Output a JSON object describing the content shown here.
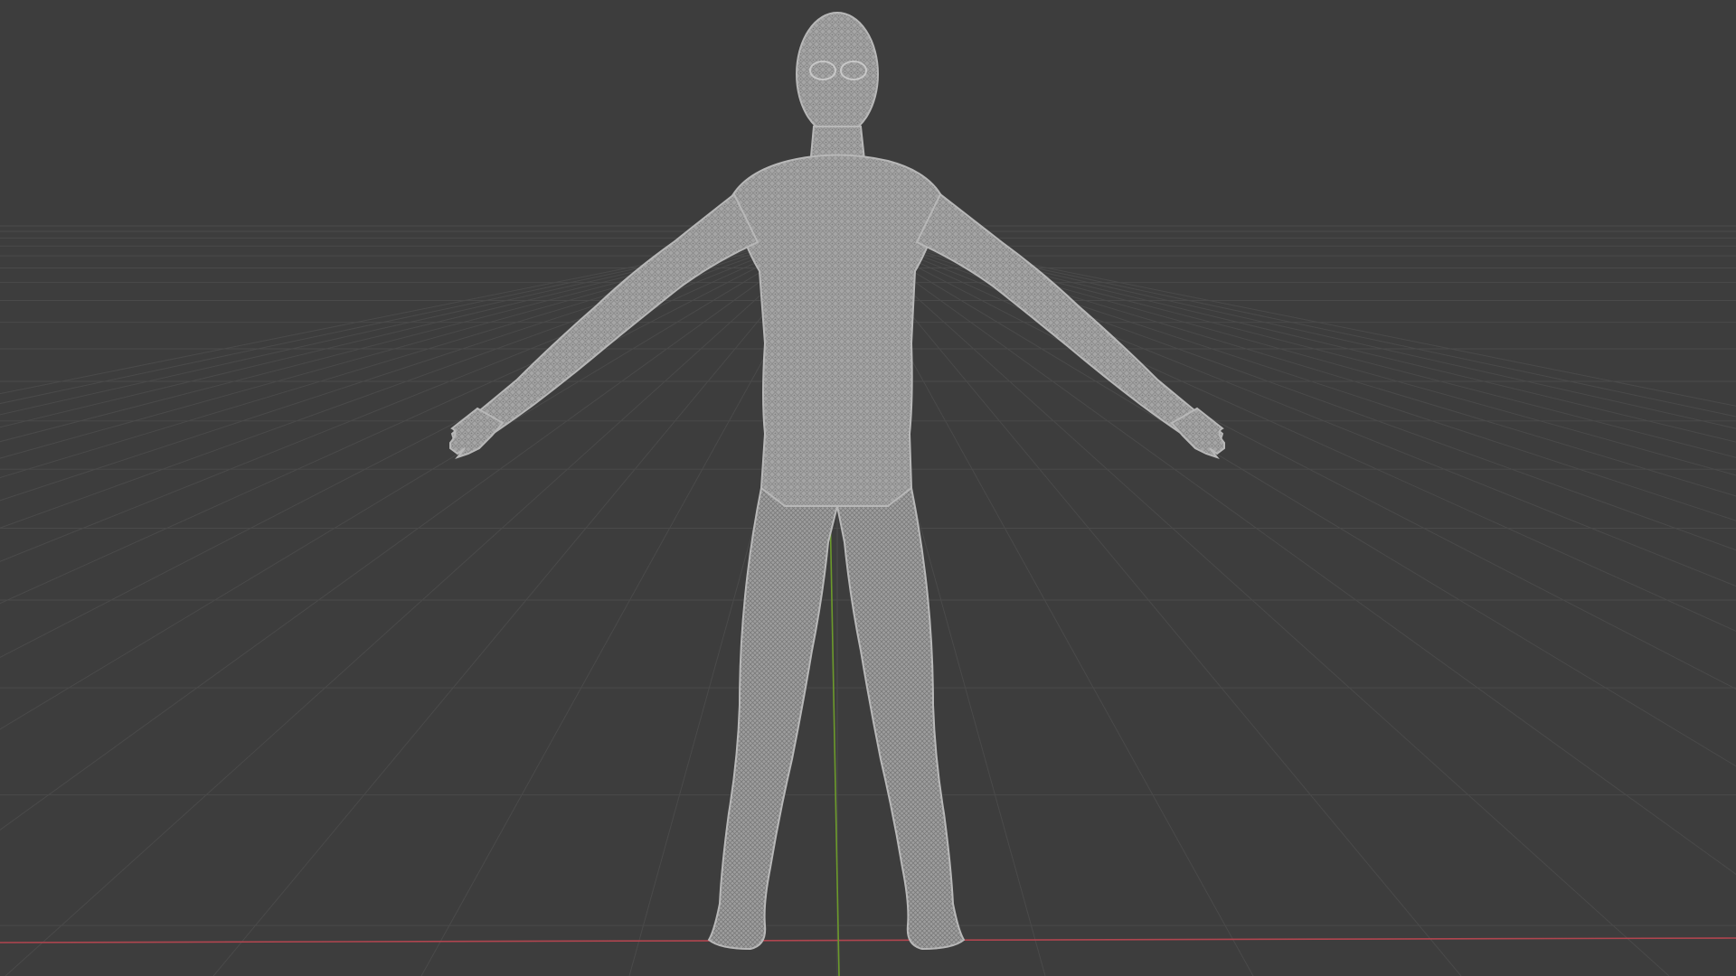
{
  "viewport": {
    "type": "3d-viewport",
    "shading": "wireframe",
    "view": "front-perspective",
    "background_color": "#3d3d3d",
    "grid_color": "#4a4a4a",
    "mesh_color": "#a9a9a9",
    "x_axis_color": "#b0454f",
    "y_axis_color": "#6c9a2b"
  },
  "object": {
    "kind": "humanoid-character-mesh",
    "pose": "A-pose",
    "selected": false
  }
}
